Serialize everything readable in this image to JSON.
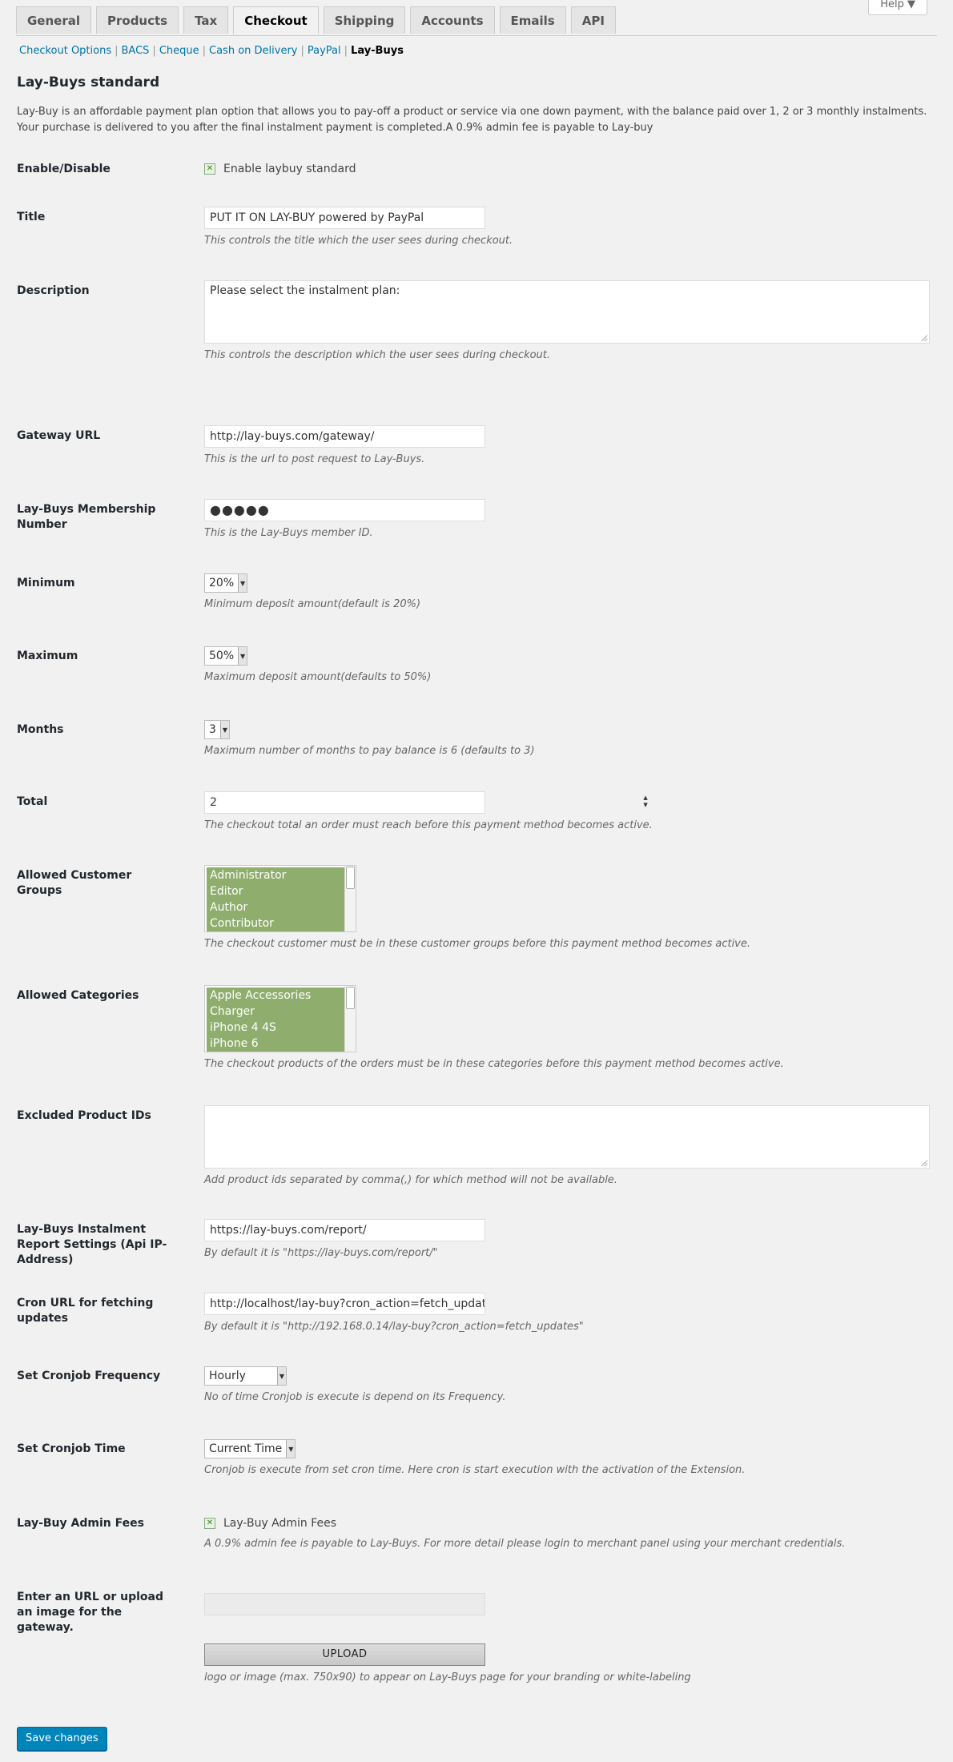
{
  "help": {
    "label": "Help"
  },
  "tabs": [
    {
      "label": "General"
    },
    {
      "label": "Products"
    },
    {
      "label": "Tax"
    },
    {
      "label": "Checkout"
    },
    {
      "label": "Shipping"
    },
    {
      "label": "Accounts"
    },
    {
      "label": "Emails"
    },
    {
      "label": "API"
    }
  ],
  "subnav": [
    {
      "label": "Checkout Options"
    },
    {
      "label": "BACS"
    },
    {
      "label": "Cheque"
    },
    {
      "label": "Cash on Delivery"
    },
    {
      "label": "PayPal"
    },
    {
      "label": "Lay-Buys"
    }
  ],
  "page": {
    "heading": "Lay-Buys standard",
    "intro": "Lay-Buy is an affordable payment plan option that allows you to pay-off a product or service via one down payment, with the balance paid over 1, 2 or 3 monthly instalments. Your purchase is delivered to you after the final instalment payment is completed.A 0.9% admin fee is payable to Lay-buy"
  },
  "fields": {
    "enable": {
      "label": "Enable/Disable",
      "checkbox_label": "Enable laybuy standard"
    },
    "title": {
      "label": "Title",
      "value": "PUT IT ON LAY-BUY powered by PayPal",
      "desc": "This controls the title which the user sees during checkout."
    },
    "description": {
      "label": "Description",
      "value": "Please select the instalment plan:",
      "desc": "This controls the description which the user sees during checkout."
    },
    "gateway_url": {
      "label": "Gateway URL",
      "value": "http://lay-buys.com/gateway/",
      "desc": "This is the url to post request to Lay-Buys."
    },
    "membership": {
      "label": "Lay-Buys Membership Number",
      "value": "●●●●●",
      "desc": "This is the Lay-Buys member ID."
    },
    "minimum": {
      "label": "Minimum",
      "value": "20%",
      "desc": "Minimum deposit amount(default is 20%)"
    },
    "maximum": {
      "label": "Maximum",
      "value": "50%",
      "desc": "Maximum deposit amount(defaults to 50%)"
    },
    "months": {
      "label": "Months",
      "value": "3",
      "desc": "Maximum number of months to pay balance is 6 (defaults to 3)"
    },
    "total": {
      "label": "Total",
      "value": "2",
      "desc": "The checkout total an order must reach before this payment method becomes active."
    },
    "customer_groups": {
      "label": "Allowed Customer Groups",
      "options": [
        "Administrator",
        "Editor",
        "Author",
        "Contributor"
      ],
      "desc": "The checkout customer must be in these customer groups before this payment method becomes active."
    },
    "categories": {
      "label": "Allowed Categories",
      "options": [
        "Apple Accessories",
        "Charger",
        "iPhone 4 4S",
        "iPhone 6"
      ],
      "desc": "The checkout products of the orders must be in these categories before this payment method becomes active."
    },
    "excluded": {
      "label": "Excluded Product IDs",
      "desc": "Add product ids separated by comma(,) for which method will not be available."
    },
    "report": {
      "label": "Lay-Buys Instalment Report Settings (Api IP-Address)",
      "value": "https://lay-buys.com/report/",
      "desc": "By default it is \"https://lay-buys.com/report/\""
    },
    "cron_url": {
      "label": "Cron URL for fetching updates",
      "value": "http://localhost/lay-buy?cron_action=fetch_updates",
      "desc": "By default it is \"http://192.168.0.14/lay-buy?cron_action=fetch_updates\""
    },
    "cron_freq": {
      "label": "Set Cronjob Frequency",
      "value": "Hourly",
      "desc": "No of time Cronjob is execute is depend on its Frequency."
    },
    "cron_time": {
      "label": "Set Cronjob Time",
      "value": "Current Time",
      "desc": "Cronjob is execute from set cron time. Here cron is start execution with the activation of the Extension."
    },
    "admin_fees": {
      "label": "Lay-Buy Admin Fees",
      "checkbox_label": "Lay-Buy Admin Fees",
      "desc": "A 0.9% admin fee is payable to Lay-Buys. For more detail please login to merchant panel using your merchant credentials."
    },
    "image": {
      "label": "Enter an URL or upload an image for the gateway.",
      "upload_label": "UPLOAD",
      "desc": "logo or image (max. 750x90) to appear on Lay-Buys page for your branding or white-labeling"
    }
  },
  "save": {
    "label": "Save changes"
  }
}
